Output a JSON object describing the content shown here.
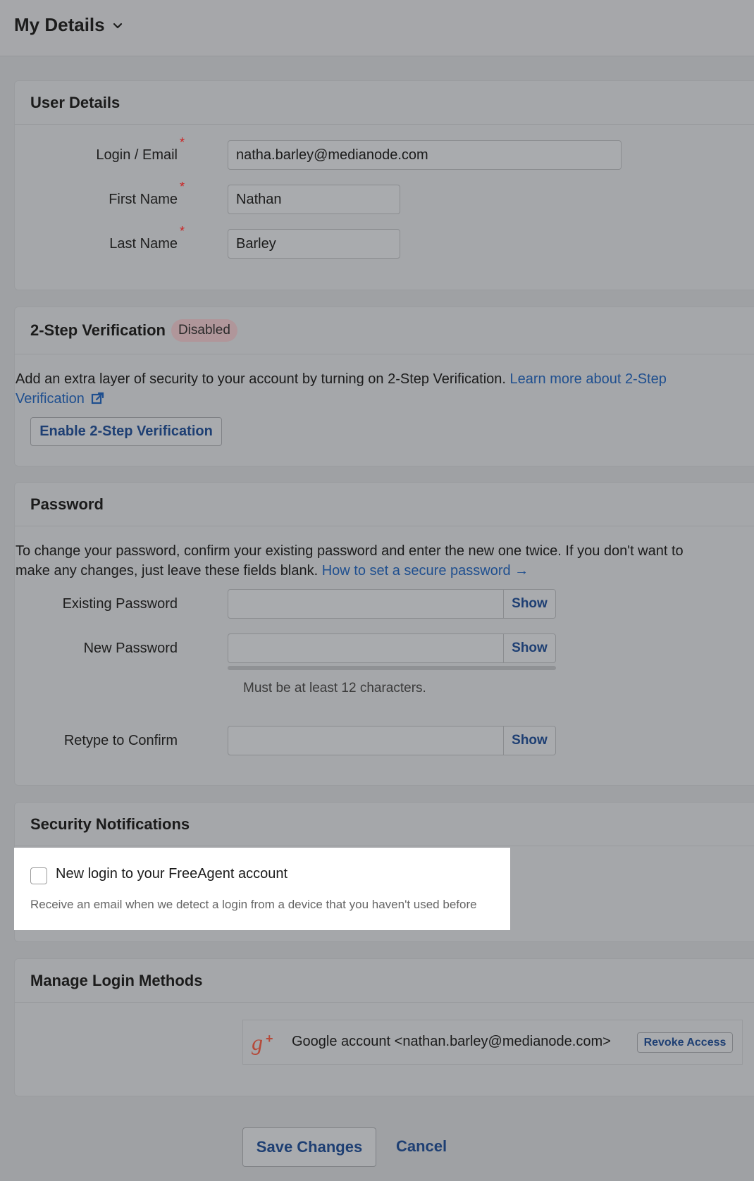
{
  "header": {
    "title": "My Details"
  },
  "user_details": {
    "title": "User Details",
    "fields": [
      {
        "label": "Login / Email",
        "value": "natha.barley@medianode.com",
        "required": "*"
      },
      {
        "label": "First Name",
        "value": "Nathan",
        "required": "*"
      },
      {
        "label": "Last Name",
        "value": "Barley",
        "required": "*"
      }
    ]
  },
  "two_step": {
    "title": "2-Step Verification",
    "status": "Disabled",
    "description": "Add an extra layer of security to your account by turning on 2-Step Verification.",
    "learn_more_line1": "Learn more about 2-Step",
    "learn_more_line2": "Verification",
    "enable_button": "Enable 2-Step Verification"
  },
  "password": {
    "title": "Password",
    "description_line1": "To change your password, confirm your existing password and enter the new one twice. If you don't want to",
    "description_line2": "make any changes, just leave these fields blank.",
    "secure_link": "How to set a secure password →",
    "fields": [
      {
        "label": "Existing Password",
        "show": "Show"
      },
      {
        "label": "New Password",
        "show": "Show"
      },
      {
        "label": "Retype to Confirm",
        "show": "Show"
      }
    ],
    "hint": "Must be at least 12 characters."
  },
  "security_notifications": {
    "title": "Security Notifications",
    "option_label": "New login to your FreeAgent account",
    "option_description": "Receive an email when we detect a login from a device that you haven't used before"
  },
  "login_methods": {
    "title": "Manage Login Methods",
    "account_text": "Google account <nathan.barley@medianode.com>",
    "revoke_button": "Revoke Access"
  },
  "footer": {
    "save_button": "Save Changes",
    "cancel_link": "Cancel"
  },
  "colors": {
    "link": "#1f4f8f",
    "required": "#cc2222",
    "google": "#b54a3a"
  }
}
